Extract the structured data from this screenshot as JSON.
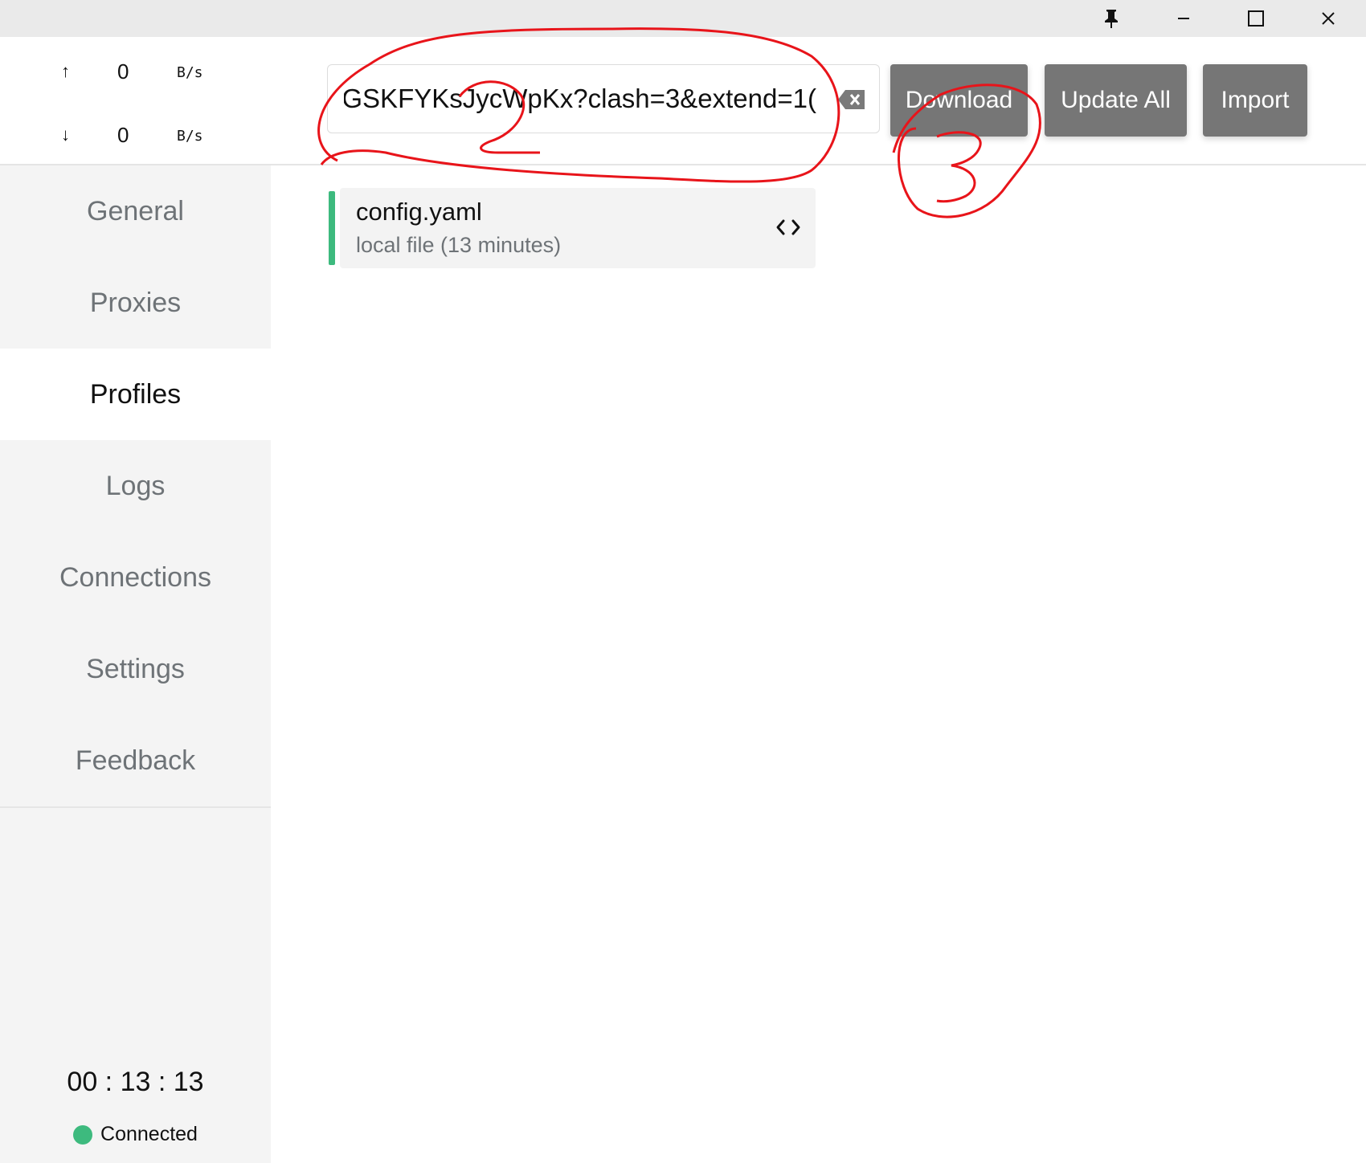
{
  "window": {
    "pin_icon": "pin-icon",
    "minimize_icon": "minimize-icon",
    "maximize_icon": "maximize-icon",
    "close_icon": "close-icon"
  },
  "traffic": {
    "upload": {
      "arrow": "↑",
      "value": "0",
      "unit": "B/s"
    },
    "download": {
      "arrow": "↓",
      "value": "0",
      "unit": "B/s"
    }
  },
  "nav": {
    "general": "General",
    "proxies": "Proxies",
    "profiles": "Profiles",
    "logs": "Logs",
    "connections": "Connections",
    "settings": "Settings",
    "feedback": "Feedback"
  },
  "status": {
    "timer": "00 : 13 : 13",
    "connection": "Connected"
  },
  "toolbar": {
    "url_value": ")GSKFYKsJycWpKx?clash=3&extend=1",
    "download_label": "Download",
    "update_all_label": "Update All",
    "import_label": "Import"
  },
  "profiles": [
    {
      "name": "config.yaml",
      "meta": "local file (13 minutes)"
    }
  ],
  "annotations": {
    "step2_label": "2",
    "step3_label": "3",
    "stroke_color": "#e8141a"
  },
  "colors": {
    "accent_green": "#3dba7e",
    "button_gray": "#767676",
    "sidebar_bg": "#f4f4f4"
  }
}
